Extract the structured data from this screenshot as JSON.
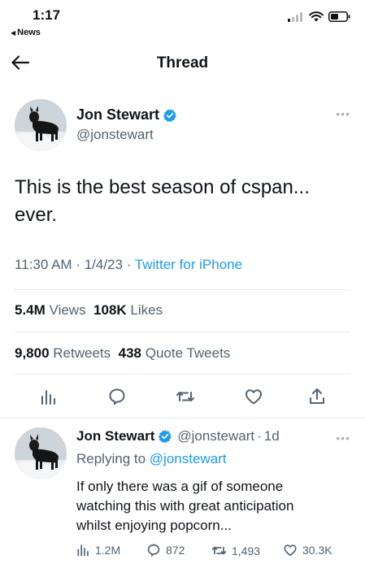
{
  "status_bar": {
    "time": "1:17",
    "back_app": "News"
  },
  "header": {
    "title": "Thread"
  },
  "main_tweet": {
    "author_name": "Jon Stewart",
    "handle": "@jonstewart",
    "text_line1": "This is the best season of cspan...",
    "text_line2": "ever.",
    "time": "11:30 AM",
    "date": "1/4/23",
    "source": "Twitter for iPhone",
    "views_count": "5.4M",
    "views_label": "Views",
    "likes_count": "108K",
    "likes_label": "Likes",
    "retweets_count": "9,800",
    "retweets_label": "Retweets",
    "quotes_count": "438",
    "quotes_label": "Quote Tweets"
  },
  "reply_tweet": {
    "author_name": "Jon Stewart",
    "handle": "@jonstewart",
    "age": "1d",
    "replying_prefix": "Replying to",
    "replying_to": "@jonstewart",
    "text_line1": "If only there was a gif of someone",
    "text_line2": "watching this with great anticipation",
    "text_line3": "whilst enjoying popcorn...",
    "views": "1.2M",
    "replies": "872",
    "retweets": "1,493",
    "likes": "30.3K"
  },
  "icons": {
    "back": "arrow-left-icon",
    "verified": "verified-badge-icon",
    "views": "bar-chart-icon",
    "reply": "speech-bubble-icon",
    "retweet": "retweet-icon",
    "like": "heart-icon",
    "share": "share-icon"
  },
  "colors": {
    "accent": "#1d9bf0",
    "secondary_text": "#536471",
    "primary_text": "#0f1419",
    "divider": "#e6ecf0"
  }
}
